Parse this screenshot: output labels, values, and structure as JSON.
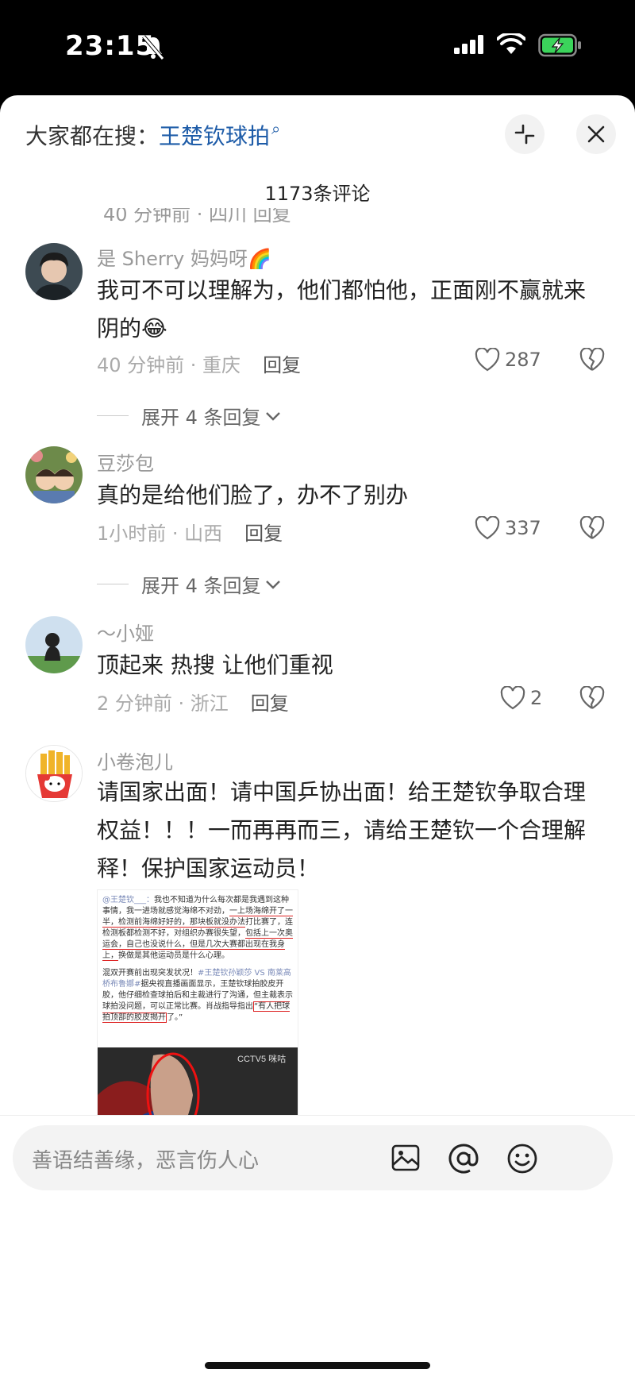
{
  "status_bar": {
    "time": "23:15"
  },
  "header": {
    "search_prefix": "大家都在搜：",
    "search_keyword": "王楚钦球拍",
    "comment_count": "1173条评论",
    "cut_off_row": "40 分钟前 · 四川     回复"
  },
  "comments": [
    {
      "username": "是 Sherry 妈妈呀🌈",
      "text": "我可不可以理解为，他们都怕他，正面刚不赢就来阴的😂",
      "time_location": "40 分钟前 · 重庆",
      "reply_label": "回复",
      "likes": "287",
      "expand_label": "展开 4 条回复"
    },
    {
      "username": "豆莎包",
      "text": "真的是给他们脸了，办不了别办",
      "time_location": "1小时前 · 山西",
      "reply_label": "回复",
      "likes": "337",
      "expand_label": "展开 4 条回复"
    },
    {
      "username": "～小娅",
      "text": "顶起来 热搜 让他们重视",
      "time_location": "2 分钟前 · 浙江",
      "reply_label": "回复",
      "likes": "2"
    },
    {
      "username": "小卷泡儿",
      "text": "请国家出面！请中国乒协出面！给王楚钦争取合理权益！！！一而再再而三，请给王楚钦一个合理解释！保护国家运动员！",
      "embedded_image": {
        "p1_handle": "@王楚钦___：",
        "p1_a": "我也不知道为什么每次都是我遇到这种事情，我一进场就感觉海绵不对劲，",
        "p1_u1": "一上场海绵开了一半，检测前海绵好好的，那块板就没办法",
        "p1_b": "打比赛了，连检测板都检测不好，对组织办赛很失望，",
        "p1_u2": "包括上一次奥运会，自己也没说什么，但是几次大赛都出现在我身上，",
        "p1_c": "换做是其他运动员是什么心理。",
        "p2_a": "混双开赛前出现突发状况！",
        "p2_tag": "#王楚钦孙颖莎 VS 南莱高桥布鲁娜#",
        "p2_b": "据央视直播画面显示，王楚钦球拍胶皮开胶，他仔细检查球拍后和主裁进行了沟通，但主裁表示球拍没问题，可以正常比赛。肖战指导指出",
        "p2_box": "“有人把球拍顶部的胶皮揭开",
        "p2_c": "了。”",
        "watermark": "CCTV5 咪咕"
      }
    }
  ],
  "bottom_bar": {
    "input_placeholder": "善语结善缘，恶言伤人心",
    "icons": [
      "image-icon",
      "at-icon",
      "emoji-icon"
    ]
  }
}
